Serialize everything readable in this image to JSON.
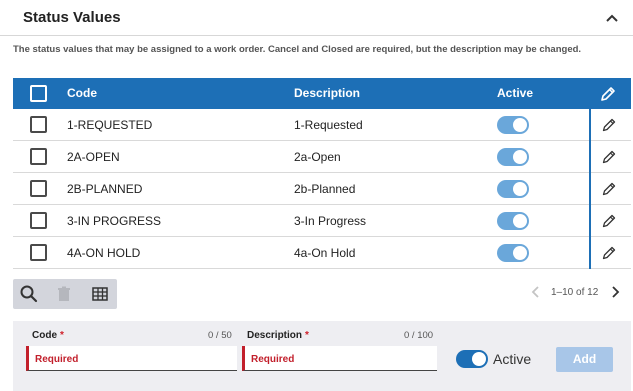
{
  "section": {
    "title": "Status Values",
    "description": "The status values that may be assigned to a work order. Cancel and Closed are required, but the description may be changed."
  },
  "grid": {
    "columns": {
      "code": "Code",
      "description": "Description",
      "active": "Active"
    },
    "rows": [
      {
        "code": "1-REQUESTED",
        "description": "1-Requested",
        "active": true
      },
      {
        "code": "2A-OPEN",
        "description": "2a-Open",
        "active": true
      },
      {
        "code": "2B-PLANNED",
        "description": "2b-Planned",
        "active": true
      },
      {
        "code": "3-IN PROGRESS",
        "description": "3-In Progress",
        "active": true
      },
      {
        "code": "4A-ON HOLD",
        "description": "4a-On Hold",
        "active": true
      }
    ]
  },
  "toolbar": {
    "icons": [
      "search-icon",
      "trash-icon",
      "columns-icon"
    ]
  },
  "pager": {
    "info": "1–10 of 12"
  },
  "add_form": {
    "code_label": "Code",
    "code_required": "*",
    "code_count": "0 / 50",
    "code_value": "Required",
    "description_label": "Description",
    "description_required": "*",
    "description_count": "0 / 100",
    "description_value": "Required",
    "active_label": "Active",
    "active": true,
    "add_label": "Add"
  },
  "colors": {
    "header_blue": "#1d6fb6",
    "toggle_on": "#6aa7da",
    "required_red": "#c21f2b",
    "add_disabled": "#a8c6e8"
  }
}
